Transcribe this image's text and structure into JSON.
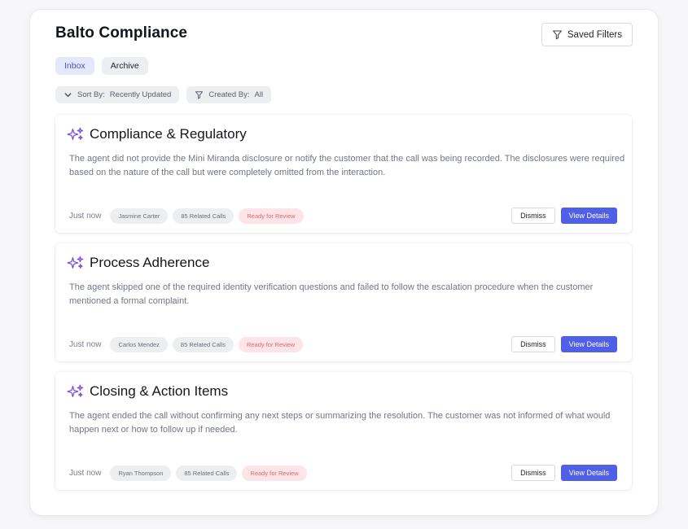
{
  "app": {
    "title": "Balto Compliance"
  },
  "header": {
    "saved_filters_label": "Saved Filters"
  },
  "tabs": [
    {
      "label": "Inbox",
      "active": true
    },
    {
      "label": "Archive",
      "active": false
    }
  ],
  "filters": {
    "sort_label": "Sort By:",
    "sort_value": "Recently Updated",
    "created_label": "Created By:",
    "created_value": "All"
  },
  "colors": {
    "accent": "#4f5fe8",
    "sparkle": "#7a4fd6",
    "review_badge_bg": "#fde4e6",
    "review_badge_text": "#e06a72"
  },
  "cards": [
    {
      "title": "Compliance & Regulatory",
      "icon": "sparkle-icon",
      "description": "The agent did not provide the Mini Miranda disclosure or notify the customer that the call was being recorded. The disclosures were required based on the nature of the call but were completely omitted from the interaction.",
      "time": "Just now",
      "agent": "Jasmine Carter",
      "related": "85 Related Calls",
      "status": "Ready for Review",
      "dismiss_label": "Dismiss",
      "view_label": "View Details"
    },
    {
      "title": "Process Adherence",
      "icon": "sparkle-icon",
      "description": "The agent skipped one of the required identity verification questions and failed to follow the escalation procedure when the customer mentioned a formal complaint.",
      "time": "Just now",
      "agent": "Carlos Mendez",
      "related": "85 Related Calls",
      "status": "Ready for Review",
      "dismiss_label": "Dismiss",
      "view_label": "View Details"
    },
    {
      "title": "Closing & Action Items",
      "icon": "sparkle-icon",
      "description": "The agent ended the call without confirming any next steps or summarizing the resolution. The customer was not informed of what would happen next or how to follow up if needed.",
      "time": "Just now",
      "agent": "Ryan Thompson",
      "related": "85 Related Calls",
      "status": "Ready for Review",
      "dismiss_label": "Dismiss",
      "view_label": "View Details"
    }
  ]
}
